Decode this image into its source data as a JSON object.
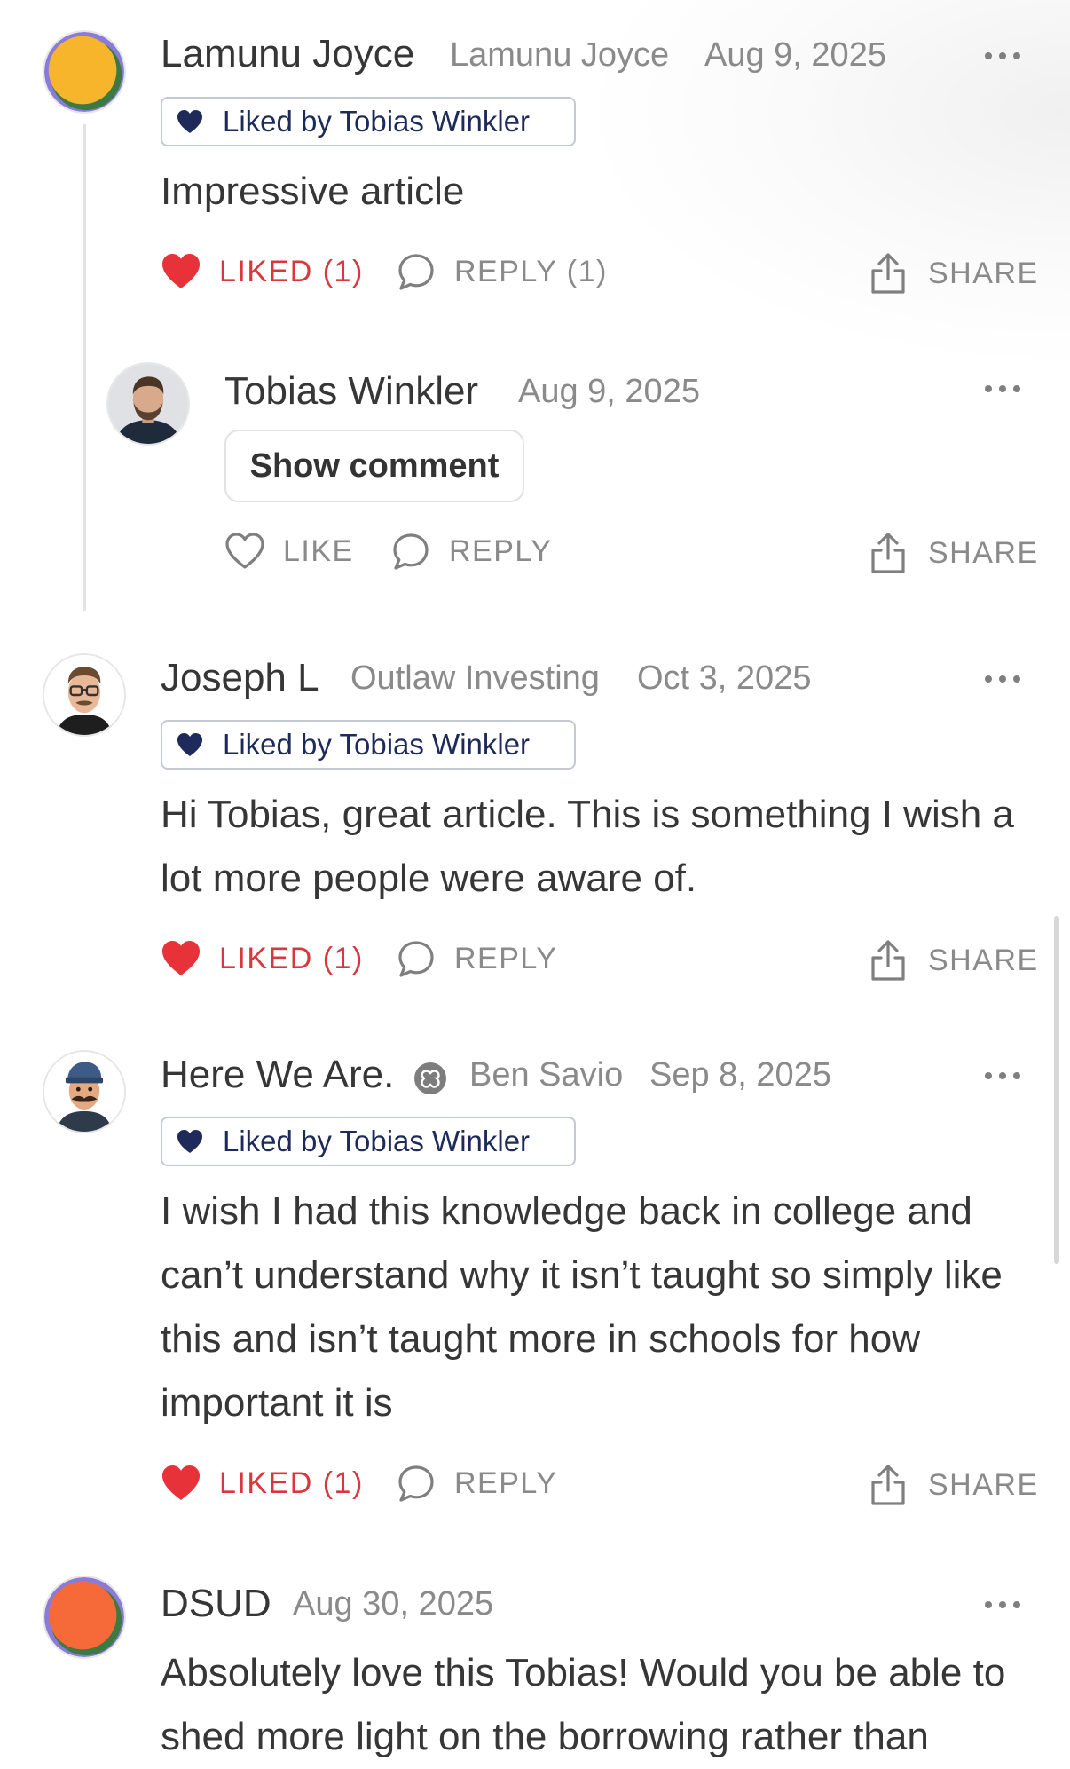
{
  "comments": [
    {
      "author": "Lamunu Joyce",
      "publication": "Lamunu Joyce",
      "date": "Aug 9, 2025",
      "liked_by": "Liked by Tobias Winkler",
      "body": "Impressive article",
      "actions": {
        "like": "LIKED (1)",
        "reply": "REPLY (1)",
        "share": "SHARE"
      },
      "avatar_colors": [
        "#f7b52c",
        "#3c7a44",
        "#8b7bd8"
      ],
      "replies": [
        {
          "author": "Tobias Winkler",
          "date": "Aug 9, 2025",
          "show_comment": "Show comment",
          "actions": {
            "like": "LIKE",
            "reply": "REPLY",
            "share": "SHARE"
          }
        }
      ]
    },
    {
      "author": "Joseph L",
      "publication": "Outlaw Investing",
      "date": "Oct 3, 2025",
      "liked_by": "Liked by Tobias Winkler",
      "body": "Hi Tobias, great article. This is something I wish a lot more people were aware of.",
      "actions": {
        "like": "LIKED (1)",
        "reply": "REPLY",
        "share": "SHARE"
      }
    },
    {
      "author": "Here We Are.",
      "publication": "Ben Savio",
      "date": "Sep 8, 2025",
      "liked_by": "Liked by Tobias Winkler",
      "body": "I wish I had this knowledge back in college and can’t understand why it isn’t taught so simply like this and isn’t taught more in schools for how important it is",
      "actions": {
        "like": "LIKED (1)",
        "reply": "REPLY",
        "share": "SHARE"
      }
    },
    {
      "author": "DSUD",
      "date": "Aug 30, 2025",
      "body": "Absolutely love this Tobias! Would you be able to shed more light on the borrowing rather than",
      "avatar_colors": [
        "#f66a3a",
        "#3c7a44",
        "#8b7bd8"
      ]
    }
  ],
  "colors": {
    "liked": "#d8373e",
    "liked_badge_heart": "#1d2a5a",
    "muted": "#8a8a8a",
    "text": "#363636"
  },
  "icons": [
    "heart-filled-icon",
    "heart-outline-icon",
    "speech-bubble-icon",
    "share-icon",
    "more-dots-icon",
    "badge-icon"
  ]
}
